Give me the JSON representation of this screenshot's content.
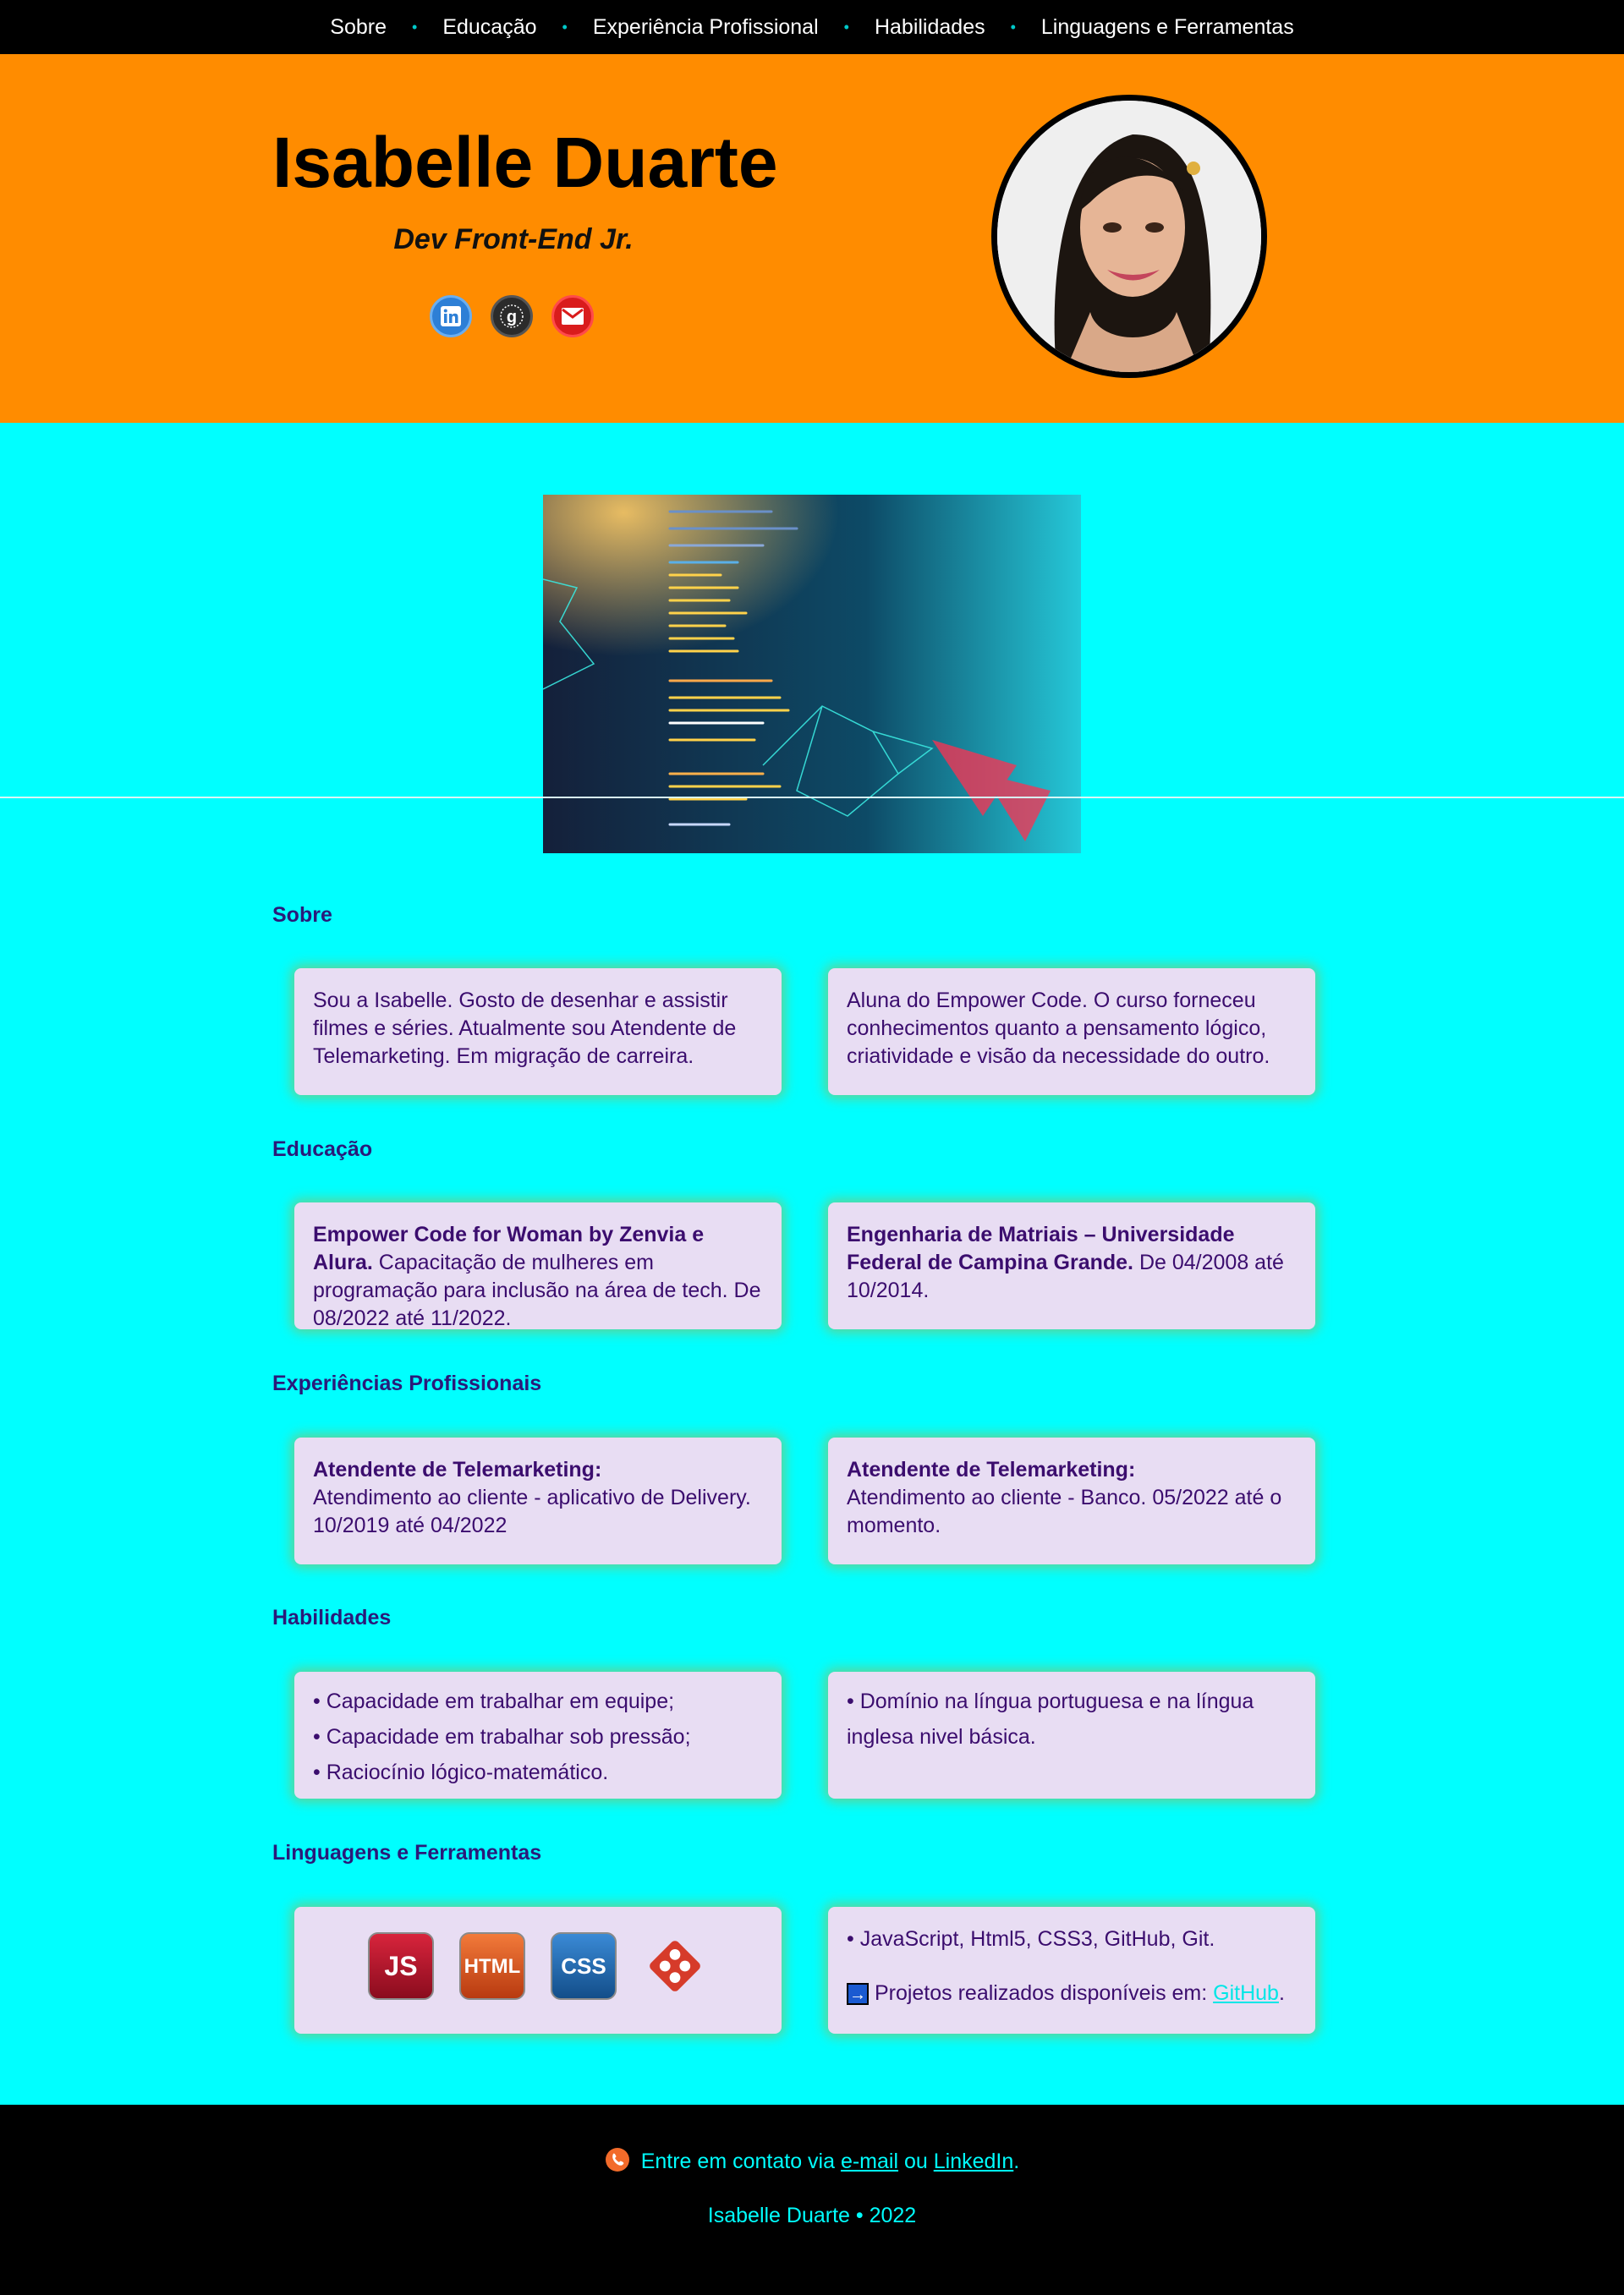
{
  "nav": {
    "items": [
      {
        "label": "Sobre"
      },
      {
        "label": "Educação"
      },
      {
        "label": "Experiência Profissional"
      },
      {
        "label": "Habilidades"
      },
      {
        "label": "Linguagens e Ferramentas"
      }
    ],
    "separator": "•"
  },
  "hero": {
    "name": "Isabelle Duarte",
    "role": "Dev Front-End Jr.",
    "socials": [
      "linkedin-icon",
      "github-icon",
      "gmail-icon"
    ],
    "accent": "#ff8c00"
  },
  "sections": {
    "sobre": {
      "title": "Sobre",
      "card1": "Sou a Isabelle. Gosto de desenhar e assistir filmes e séries. Atualmente sou Atendente de Telemarketing. Em migração de carreira.",
      "card2": "Aluna do Empower Code. O curso forneceu conhecimentos quanto a pensamento lógico, criatividade e visão da necessidade do outro."
    },
    "educacao": {
      "title": "Educação",
      "card1_bold": "Empower Code for Woman by Zenvia e Alura.",
      "card1_text": " Capacitação de mulheres em programação para inclusão na área de tech. De 08/2022 até 11/2022.",
      "card2_bold": "Engenharia de Matriais – Universidade Federal de Campina Grande.",
      "card2_text": " De 04/2008 até 10/2014."
    },
    "experiencias": {
      "title": "Experiências Profissionais",
      "card1_bold": "Atendente de Telemarketing:",
      "card1_text": "Atendimento ao cliente - aplicativo de Delivery. 10/2019 até 04/2022",
      "card2_bold": "Atendente de Telemarketing:",
      "card2_text": "Atendimento ao cliente - Banco. 05/2022 até o momento."
    },
    "habilidades": {
      "title": "Habilidades",
      "list1": [
        "• Capacidade em trabalhar em equipe;",
        "• Capacidade em trabalhar sob pressão;",
        "• Raciocínio lógico-matemático."
      ],
      "list2": [
        "• Domínio na língua portuguesa e na língua inglesa nivel básica."
      ]
    },
    "linguagens": {
      "title": "Linguagens e Ferramentas",
      "badges": [
        "JS",
        "HTML",
        "CSS"
      ],
      "git_icon": "git-icon",
      "tools": "• JavaScript, Html5, CSS3, GitHub, Git.",
      "projects_prefix": " Projetos realizados disponíveis em: ",
      "projects_link": "GitHub",
      "projects_suffix": "."
    }
  },
  "footer": {
    "contact_prefix": " Entre em contato via ",
    "email_link": "e-mail",
    "contact_mid": " ou ",
    "linkedin_link": "LinkedIn",
    "contact_suffix": ".",
    "copyright": "Isabelle Duarte • 2022"
  }
}
